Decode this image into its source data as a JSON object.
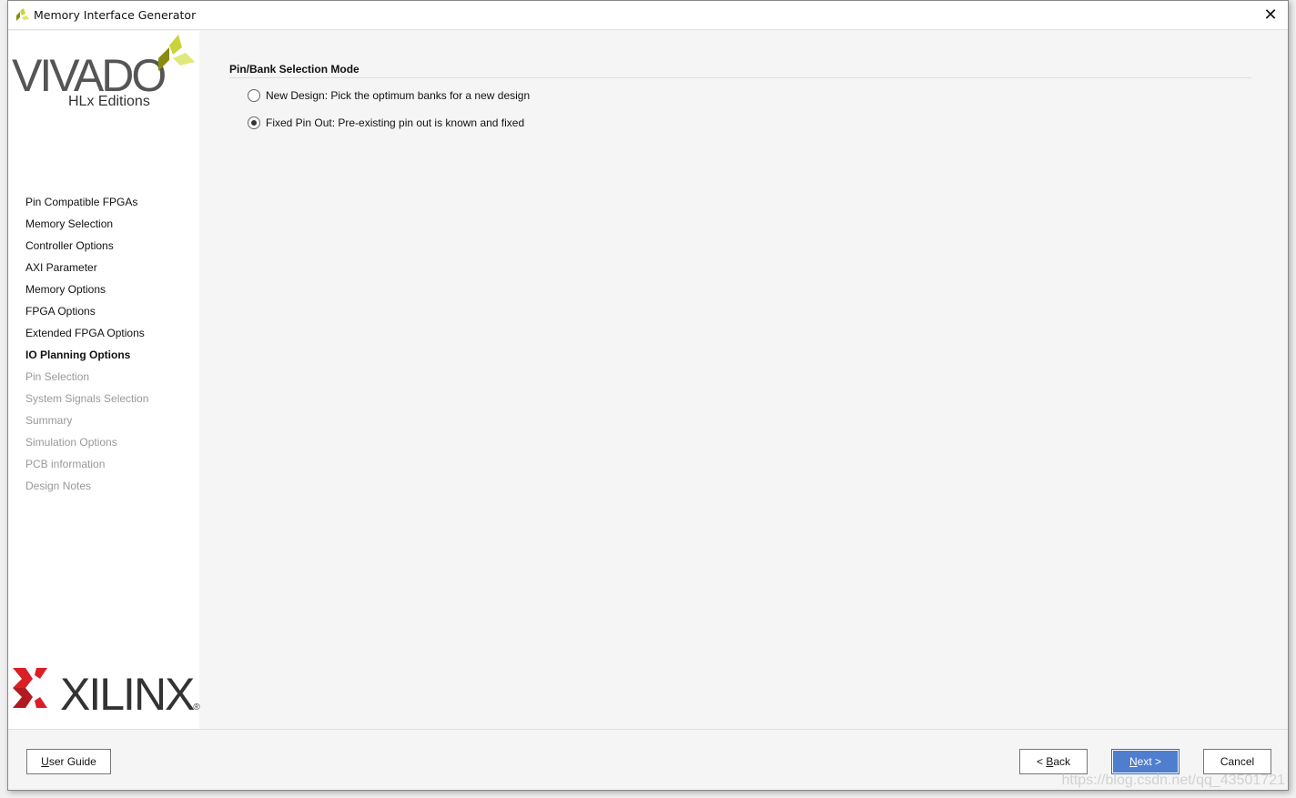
{
  "window": {
    "title": "Memory Interface Generator",
    "close_icon": "close-icon"
  },
  "branding": {
    "vivado": "VIVADO",
    "hlx": "HLx Editions",
    "xilinx": "XILINX"
  },
  "steps": [
    {
      "label": "Pin Compatible FPGAs",
      "state": "done"
    },
    {
      "label": "Memory Selection",
      "state": "done"
    },
    {
      "label": "Controller Options",
      "state": "done"
    },
    {
      "label": "AXI Parameter",
      "state": "done"
    },
    {
      "label": "Memory Options",
      "state": "done"
    },
    {
      "label": "FPGA Options",
      "state": "done"
    },
    {
      "label": "Extended FPGA Options",
      "state": "done"
    },
    {
      "label": "IO Planning Options",
      "state": "current"
    },
    {
      "label": "Pin Selection",
      "state": "disabled"
    },
    {
      "label": "System Signals Selection",
      "state": "disabled"
    },
    {
      "label": "Summary",
      "state": "disabled"
    },
    {
      "label": "Simulation Options",
      "state": "disabled"
    },
    {
      "label": "PCB information",
      "state": "disabled"
    },
    {
      "label": "Design Notes",
      "state": "disabled"
    }
  ],
  "main": {
    "section_title": "Pin/Bank Selection Mode",
    "options": [
      {
        "label": "New Design: Pick the optimum banks for a new design",
        "selected": false
      },
      {
        "label": "Fixed Pin Out: Pre-existing pin out is known and fixed",
        "selected": true
      }
    ]
  },
  "footer": {
    "user_guide_u": "U",
    "user_guide_rest": "ser Guide",
    "back_pre": "< ",
    "back_u": "B",
    "back_rest": "ack",
    "next_u": "N",
    "next_rest": "ext >",
    "cancel": "Cancel"
  },
  "watermark": "https://blog.csdn.net/qq_43501721",
  "colors": {
    "primary_button": "#4f7ecf",
    "xilinx_red": "#d92027",
    "vivado_green": "#c8d43a"
  }
}
